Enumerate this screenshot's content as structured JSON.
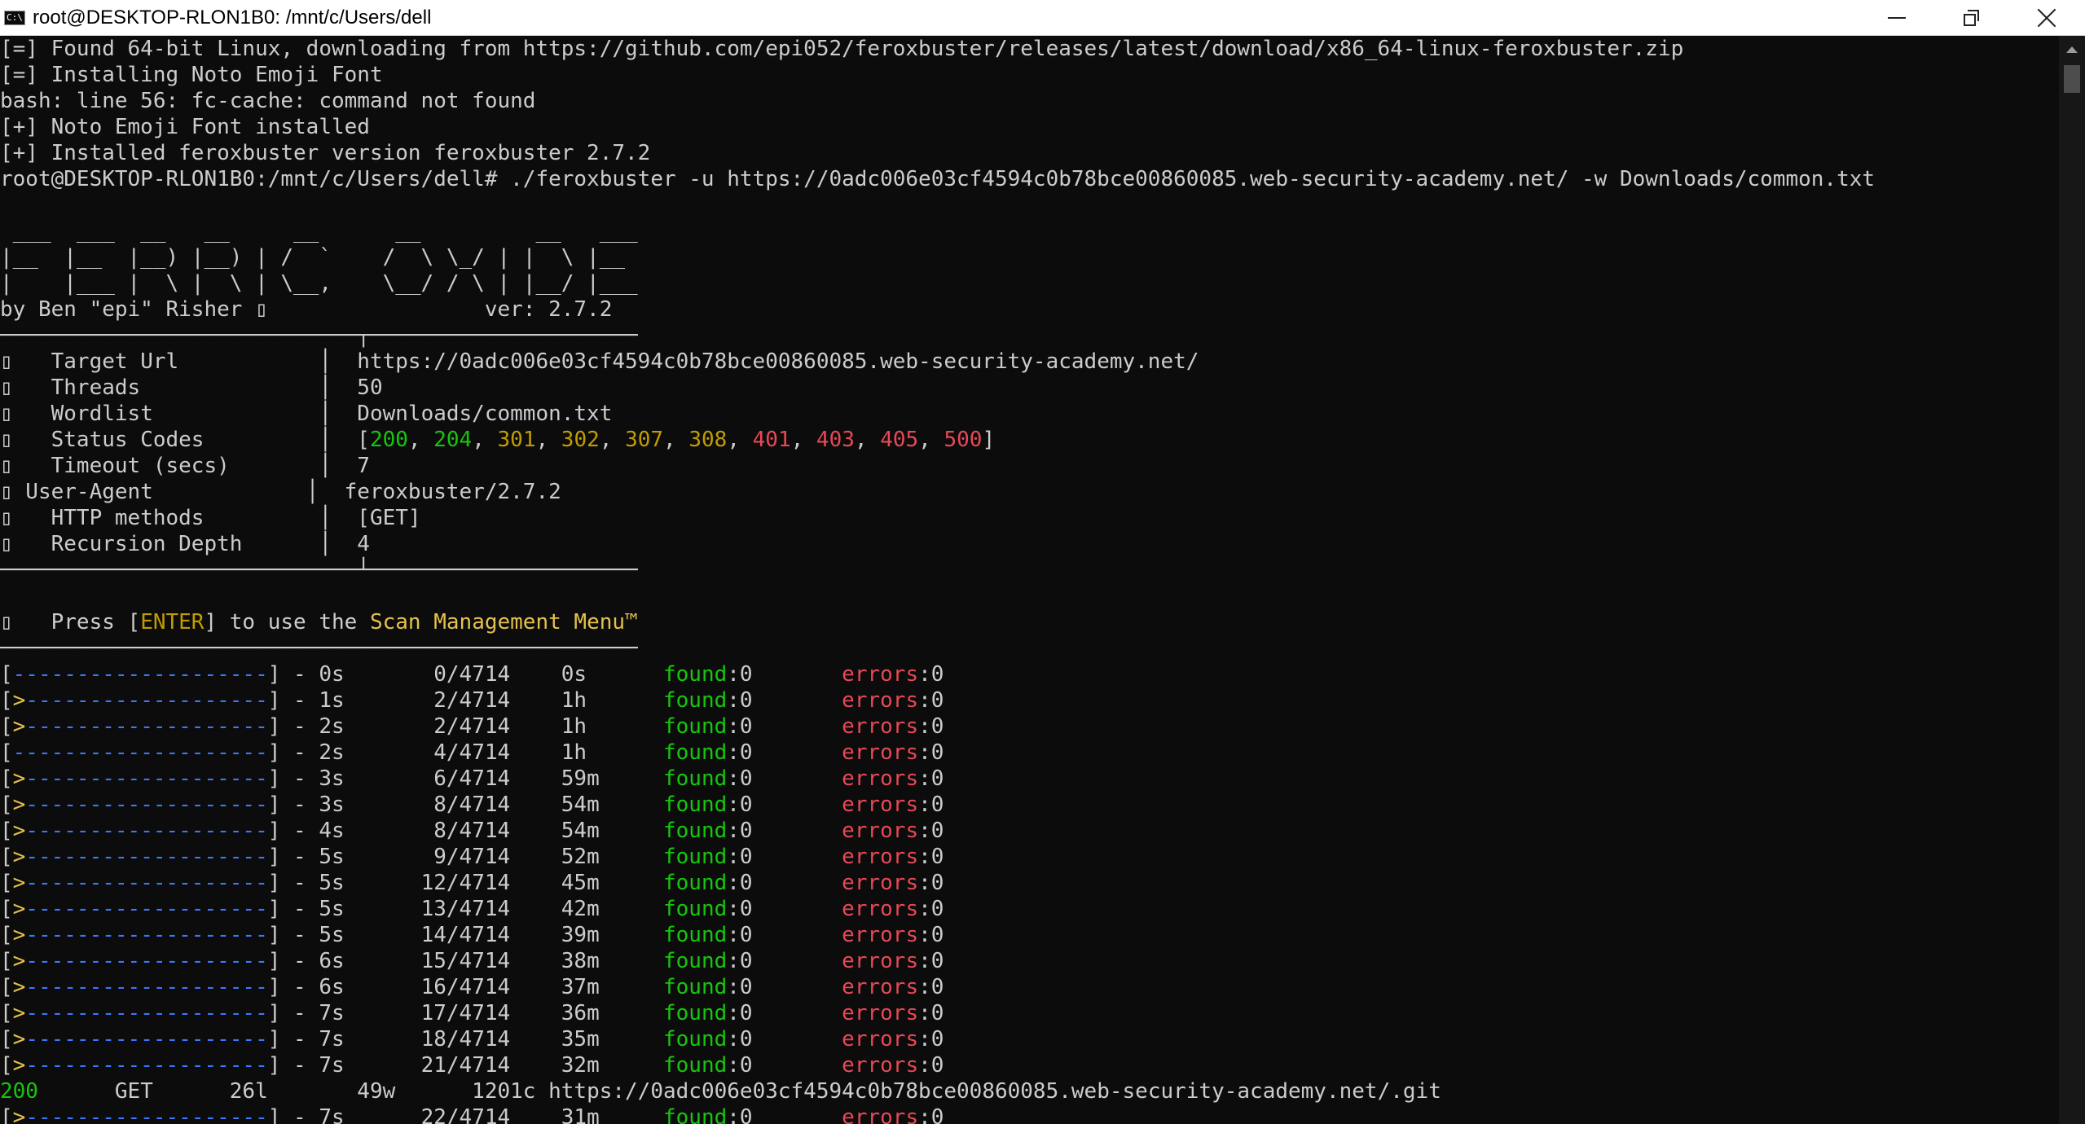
{
  "window": {
    "title": "root@DESKTOP-RLON1B0: /mnt/c/Users/dell",
    "icon_text": "C:\\.",
    "controls": [
      "minimize-icon",
      "maximize-icon",
      "close-icon"
    ]
  },
  "colors": {
    "console_bg": "#0c0c0c",
    "text": "#cccccc",
    "green": "#16c60c",
    "yellow": "#e5c14b",
    "red": "#e74856",
    "blue": "#3b78ff"
  },
  "setup_lines": [
    "[=] Found 64-bit Linux, downloading from https://github.com/epi052/feroxbuster/releases/latest/download/x86_64-linux-feroxbuster.zip",
    "[=] Installing Noto Emoji Font",
    "bash: line 56: fc-cache: command not found",
    "[+] Noto Emoji Font installed",
    "[+] Installed feroxbuster version feroxbuster 2.7.2"
  ],
  "prompt": "root@DESKTOP-RLON1B0:/mnt/c/Users/dell# ./feroxbuster -u https://0adc006e03cf4594c0b78bce00860085.web-security-academy.net/ -w Downloads/common.txt",
  "banner": [
    " ___  ___  __   __     __      __         __   ___",
    "|__  |__  |__) |__) | /  `    /  \\ \\_/ | |  \\ |__",
    "|    |___ |  \\ |  \\ | \\__,    \\__/ / \\ | |__/ |___",
    "by Ben \"epi\" Risher ▯                 ver: 2.7.2"
  ],
  "divider": "────────────────────────────┬─────────────────────",
  "divider_end": "────────────────────────────┴─────────────────────",
  "divider_plain": "──────────────────────────────────────────────────",
  "config_rows": [
    {
      "icon": "▯",
      "label": "Target Url",
      "value": "https://0adc006e03cf4594c0b78bce00860085.web-security-academy.net/"
    },
    {
      "icon": "▯",
      "label": "Threads",
      "value": "50"
    },
    {
      "icon": "▯",
      "label": "Wordlist",
      "value": "Downloads/common.txt"
    },
    {
      "icon": "▯",
      "label": "Timeout (secs)",
      "value": "7"
    },
    {
      "icon": "▯",
      "label": "User-Agent",
      "value": "feroxbuster/2.7.2"
    },
    {
      "icon": "▯",
      "label": "HTTP methods",
      "value": "[GET]"
    },
    {
      "icon": "▯",
      "label": "Recursion Depth",
      "value": "4"
    }
  ],
  "status_codes": {
    "icon": "▯",
    "label": "Status Codes",
    "green": [
      "200",
      "204"
    ],
    "yellow": [
      "301",
      "302",
      "307",
      "308"
    ],
    "red": [
      "401",
      "403",
      "405",
      "500"
    ]
  },
  "press_enter": {
    "icon": "▯",
    "prefix": "Press [",
    "key": "ENTER",
    "middle": "] to use the ",
    "menu": "Scan Management Menu™"
  },
  "progress_bar_empty": "--------------------",
  "progress_bar_active": ">-------------------",
  "progress_rows": [
    {
      "elapsed": "0s",
      "count": "0/4714",
      "eta": "0s",
      "found": "0",
      "errors": "0",
      "started": false
    },
    {
      "elapsed": "1s",
      "count": "2/4714",
      "eta": "1h",
      "found": "0",
      "errors": "0",
      "started": true
    },
    {
      "elapsed": "2s",
      "count": "2/4714",
      "eta": "1h",
      "found": "0",
      "errors": "0",
      "started": true
    },
    {
      "elapsed": "2s",
      "count": "4/4714",
      "eta": "1h",
      "found": "0",
      "errors": "0",
      "started": false
    },
    {
      "elapsed": "3s",
      "count": "6/4714",
      "eta": "59m",
      "found": "0",
      "errors": "0",
      "started": true
    },
    {
      "elapsed": "3s",
      "count": "8/4714",
      "eta": "54m",
      "found": "0",
      "errors": "0",
      "started": true
    },
    {
      "elapsed": "4s",
      "count": "8/4714",
      "eta": "54m",
      "found": "0",
      "errors": "0",
      "started": true
    },
    {
      "elapsed": "5s",
      "count": "9/4714",
      "eta": "52m",
      "found": "0",
      "errors": "0",
      "started": true
    },
    {
      "elapsed": "5s",
      "count": "12/4714",
      "eta": "45m",
      "found": "0",
      "errors": "0",
      "started": true
    },
    {
      "elapsed": "5s",
      "count": "13/4714",
      "eta": "42m",
      "found": "0",
      "errors": "0",
      "started": true
    },
    {
      "elapsed": "5s",
      "count": "14/4714",
      "eta": "39m",
      "found": "0",
      "errors": "0",
      "started": true
    },
    {
      "elapsed": "6s",
      "count": "15/4714",
      "eta": "38m",
      "found": "0",
      "errors": "0",
      "started": true
    },
    {
      "elapsed": "6s",
      "count": "16/4714",
      "eta": "37m",
      "found": "0",
      "errors": "0",
      "started": true
    },
    {
      "elapsed": "7s",
      "count": "17/4714",
      "eta": "36m",
      "found": "0",
      "errors": "0",
      "started": true
    },
    {
      "elapsed": "7s",
      "count": "18/4714",
      "eta": "35m",
      "found": "0",
      "errors": "0",
      "started": true
    },
    {
      "elapsed": "7s",
      "count": "21/4714",
      "eta": "32m",
      "found": "0",
      "errors": "0",
      "started": true
    }
  ],
  "result_line": {
    "status": "200",
    "method": "GET",
    "lines": "26l",
    "words": "49w",
    "chars": "1201c",
    "url": "https://0adc006e03cf4594c0b78bce00860085.web-security-academy.net/.git"
  },
  "last_progress": {
    "elapsed": "7s",
    "count": "22/4714",
    "eta": "31m",
    "found": "0",
    "errors": "0",
    "started": true
  },
  "labels": {
    "found": "found",
    "errors": "errors"
  }
}
